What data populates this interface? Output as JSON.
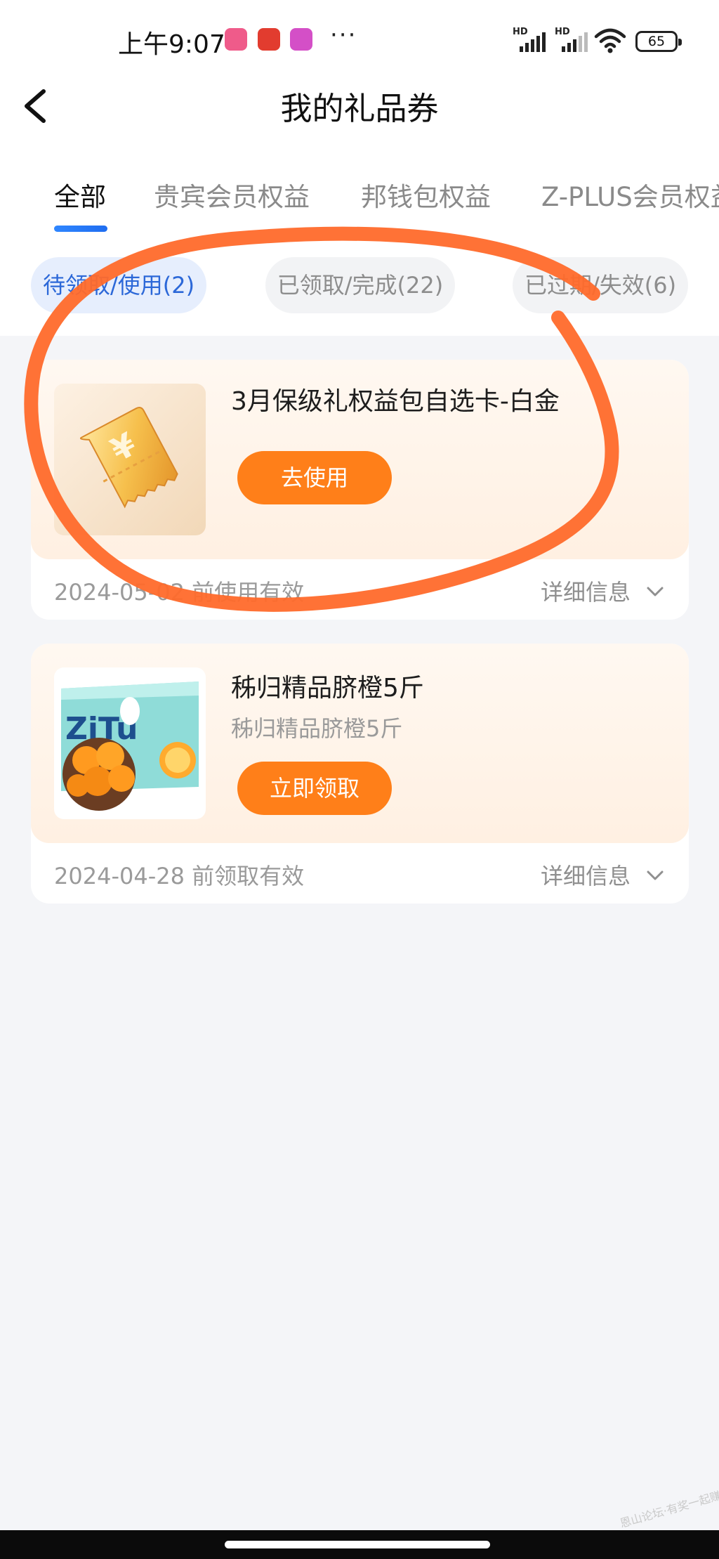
{
  "status_bar": {
    "time": "上午9:07",
    "more": "···",
    "signal_label_1": "HD",
    "signal_label_2": "HD",
    "battery": "65"
  },
  "header": {
    "title": "我的礼品券"
  },
  "tabs": [
    {
      "label": "全部",
      "active": true
    },
    {
      "label": "贵宾会员权益",
      "active": false
    },
    {
      "label": "邦钱包权益",
      "active": false
    },
    {
      "label": "Z-PLUS会员权益",
      "active": false
    }
  ],
  "filters": [
    {
      "label": "待领取/使用(2)",
      "active": true
    },
    {
      "label": "已领取/完成(22)",
      "active": false
    },
    {
      "label": "已过期/失效(6)",
      "active": false
    }
  ],
  "coupons": [
    {
      "title": "3月保级礼权益包自选卡-白金",
      "subtitle": "",
      "button": "去使用",
      "expiry": "2024-05-02 前使用有效",
      "detail": "详细信息"
    },
    {
      "title": "秭归精品脐橙5斤",
      "subtitle": "秭归精品脐橙5斤",
      "button": "立即领取",
      "expiry": "2024-04-28 前领取有效",
      "detail": "详细信息"
    }
  ],
  "product_box_text": "ZiTu",
  "colors": {
    "accent_orange": "#ff7f19",
    "active_blue": "#2c68d8",
    "annotation": "#ff6a2b"
  },
  "watermark": "恩山论坛·有奖一起赚"
}
